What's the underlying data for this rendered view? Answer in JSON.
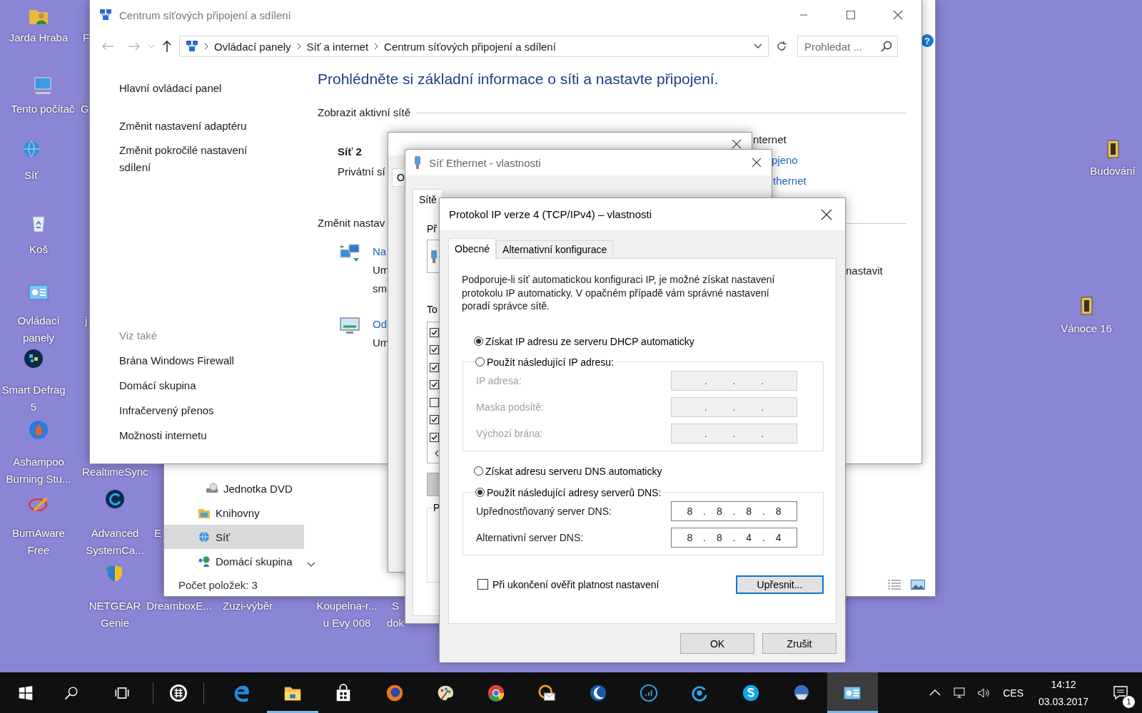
{
  "desktop": {
    "icons": [
      {
        "label": "Jarda Hraba"
      },
      {
        "label": "Tento počítač"
      },
      {
        "label": "Síť"
      },
      {
        "label": "Koš"
      },
      {
        "label": "Ovládací panely"
      },
      {
        "label": "Smart Defrag 5"
      },
      {
        "label": "Ashampoo Burning Stu..."
      },
      {
        "label": "BurnAware Free"
      },
      {
        "label": "Advanced SystemCa..."
      },
      {
        "label": "NETGEAR Genie"
      },
      {
        "label": "Budování"
      },
      {
        "label": "Vánoce 16"
      }
    ],
    "covered_labels": [
      {
        "label": "F"
      },
      {
        "label": "G"
      },
      {
        "label": "j"
      },
      {
        "label": "RealtimeSync"
      },
      {
        "label": "E"
      },
      {
        "label": "DreamboxE..."
      },
      {
        "label": "Zuzi-výběr"
      },
      {
        "label": "Koupelna-r... u Evy 008"
      },
      {
        "label": "S dok"
      }
    ]
  },
  "explorer": {
    "help": "?",
    "nav_items": [
      {
        "label": "Jednotka DVD",
        "selected": false
      },
      {
        "label": "Knihovny",
        "selected": false
      },
      {
        "label": "Síť",
        "selected": true
      },
      {
        "label": "Domácí skupina",
        "selected": false
      }
    ],
    "status": "Počet položek: 3"
  },
  "network_center": {
    "title": "Centrum síťových připojení a sdílení",
    "address": [
      "Ovládací panely",
      "Síť a internet",
      "Centrum síťových připojení a sdílení"
    ],
    "search": {
      "placeholder": "Prohledat ..."
    },
    "sidebar": {
      "links": [
        "Hlavní ovládací panel",
        "Změnit nastavení adaptéru",
        "Změnit pokročilé nastavení sdílení"
      ],
      "see_also_heading": "Viz také",
      "see_also": [
        "Brána Windows Firewall",
        "Domácí skupina",
        "Infračervený přenos",
        "Možnosti internetu"
      ]
    },
    "heading": "Prohlédněte si základní informace o síti a nastavte připojení.",
    "active_networks": "Zobrazit aktivní sítě",
    "network_name": "Síť 2",
    "network_type": "Privátní sí",
    "access_type": "nternet",
    "connections_label": "pjeno",
    "connection_link": "thernet",
    "change_settings": "Změnit nastav",
    "tasks": [
      {
        "link": "Na",
        "description": [
          "Um",
          "sm"
        ]
      },
      {
        "link": "Od",
        "description": [
          "Um"
        ]
      }
    ],
    "task_text_tail": "nastavit"
  },
  "status_window": {
    "tab": "O"
  },
  "properties_window": {
    "title": "Síť Ethernet - vlastnosti",
    "tab": {
      "label": "Sítě",
      "selected": true
    },
    "connect_label": "Př",
    "components_label": "To",
    "group_label": "P",
    "components": [
      {
        "checked": true
      },
      {
        "checked": true
      },
      {
        "checked": true
      },
      {
        "checked": true
      },
      {
        "checked": false
      },
      {
        "checked": true
      },
      {
        "checked": true
      }
    ]
  },
  "ipv4_dialog": {
    "title": "Protokol IP verze 4 (TCP/IPv4) – vlastnosti",
    "tabs": [
      {
        "label": "Obecné",
        "selected": true
      },
      {
        "label": "Alternativní konfigurace",
        "selected": false
      }
    ],
    "description": "Podporuje-li síť automatickou konfiguraci IP, je možné získat nastavení protokolu IP automaticky. V opačném případě vám správné nastavení poradí správce sítě.",
    "ip_options": [
      {
        "label": "Získat IP adresu ze serveru DHCP automaticky",
        "selected": true
      },
      {
        "label": "Použít následující IP adresu:",
        "selected": false
      }
    ],
    "ip_fields": [
      {
        "label": "IP adresa:",
        "value": ". . .",
        "disabled": true
      },
      {
        "label": "Maska podsítě:",
        "value": ". . .",
        "disabled": true
      },
      {
        "label": "Výchozí brána:",
        "value": ". . .",
        "disabled": true
      }
    ],
    "dns_options": [
      {
        "label": "Získat adresu serveru DNS automaticky",
        "selected": false
      },
      {
        "label": "Použít následující adresy serverů DNS:",
        "selected": true
      }
    ],
    "dns_fields": [
      {
        "label": "Upřednostňovaný server DNS:",
        "value": "8 . 8 . 8 . 8",
        "disabled": false
      },
      {
        "label": "Alternativní server DNS:",
        "value": "8 . 8 . 4 . 4",
        "disabled": false
      }
    ],
    "validate": {
      "label": "Při ukončení ověřit platnost nastavení",
      "checked": false
    },
    "advanced_button": "Upřesnit...",
    "ok_button": "OK",
    "cancel_button": "Zrušit"
  },
  "taskbar": {
    "apps": [
      {
        "running": false,
        "active": false
      },
      {
        "running": false,
        "active": false
      },
      {
        "running": true,
        "active": false
      },
      {
        "running": false,
        "active": false
      },
      {
        "running": false,
        "active": false
      },
      {
        "running": false,
        "active": false
      },
      {
        "running": false,
        "active": false
      },
      {
        "running": false,
        "active": false
      },
      {
        "running": false,
        "active": false
      },
      {
        "running": false,
        "active": false
      },
      {
        "running": false,
        "active": false
      },
      {
        "running": false,
        "active": false
      },
      {
        "running": false,
        "active": false
      },
      {
        "running": true,
        "active": true
      }
    ],
    "language": "CES",
    "time": "14:12",
    "date": "03.03.2017",
    "notifications": "1"
  }
}
